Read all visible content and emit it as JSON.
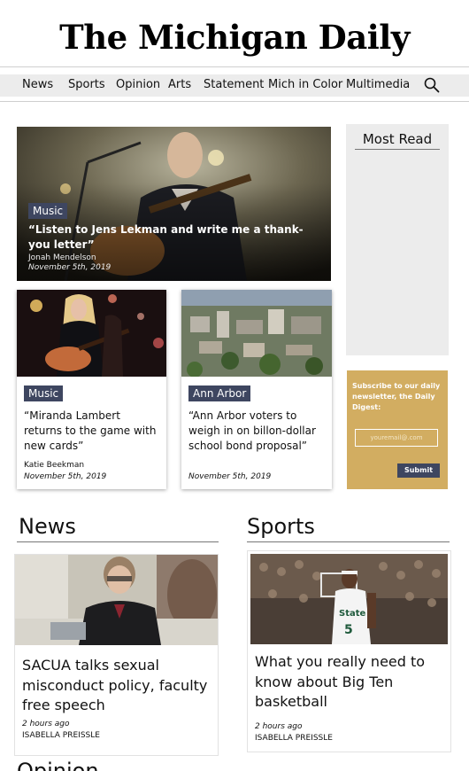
{
  "masthead": {
    "title": "The Michigan Daily"
  },
  "nav": {
    "items": [
      "News",
      "Sports",
      "Opinion",
      "Arts",
      "Statement",
      "Mich in Color",
      "Multimedia"
    ],
    "search_icon": "search-icon"
  },
  "hero": {
    "tag": "Music",
    "headline": "“Listen to Jens Lekman and write me a thank-you letter”",
    "author": "Jonah Mendelson",
    "date": "November 5th, 2019"
  },
  "cards": [
    {
      "tag": "Music",
      "headline": "“Miranda Lambert returns to the game with new cards”",
      "author": "Katie Beekman",
      "date": "November 5th, 2019"
    },
    {
      "tag": "Ann Arbor",
      "headline": "“Ann Arbor voters to weigh in on billon-dollar school bond proposal”",
      "date": "November 5th, 2019"
    }
  ],
  "sidebar": {
    "most_read_title": "Most Read",
    "newsletter": {
      "text": "Subscribe to our daily newsletter, the Daily Digest:",
      "placeholder": "youremail@.com",
      "submit": "Submit"
    }
  },
  "sections": {
    "news": {
      "title": "News",
      "headline": "SACUA talks sexual misconduct policy, faculty free speech",
      "time": "2 hours ago",
      "author": "ISABELLA PREISSLE"
    },
    "sports": {
      "title": "Sports",
      "headline": "What you really need to know about Big Ten basketball",
      "time": "2 hours ago",
      "author": "ISABELLA PREISSLE"
    },
    "opinion": {
      "title": "Opinion"
    }
  },
  "colors": {
    "tag_bg": "#3e4660",
    "newsletter_bg": "#d2ad61",
    "nav_bg": "#ececec"
  }
}
